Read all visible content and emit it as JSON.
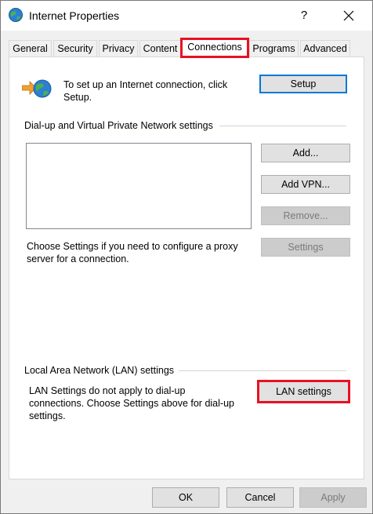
{
  "window": {
    "title": "Internet Properties",
    "help_glyph": "?"
  },
  "tabs": [
    {
      "label": "General"
    },
    {
      "label": "Security"
    },
    {
      "label": "Privacy"
    },
    {
      "label": "Content"
    },
    {
      "label": "Connections",
      "selected": true
    },
    {
      "label": "Programs"
    },
    {
      "label": "Advanced"
    }
  ],
  "setup": {
    "text_line1": "To set up an Internet connection, click",
    "text_line2": "Setup.",
    "button": "Setup"
  },
  "dialup": {
    "group_label": "Dial-up and Virtual Private Network settings",
    "add_button": "Add...",
    "add_vpn_button": "Add VPN...",
    "remove_button": "Remove...",
    "settings_text_line1": "Choose Settings if you need to configure a proxy",
    "settings_text_line2": "server for a connection.",
    "settings_button": "Settings"
  },
  "lan": {
    "group_label": "Local Area Network (LAN) settings",
    "text_line1": "LAN Settings do not apply to dial-up",
    "text_line2": "connections. Choose Settings above for dial-up",
    "text_line3": "settings.",
    "button": "LAN settings"
  },
  "footer": {
    "ok": "OK",
    "cancel": "Cancel",
    "apply": "Apply"
  },
  "colors": {
    "highlight": "#e81123",
    "accent": "#0078d7"
  }
}
